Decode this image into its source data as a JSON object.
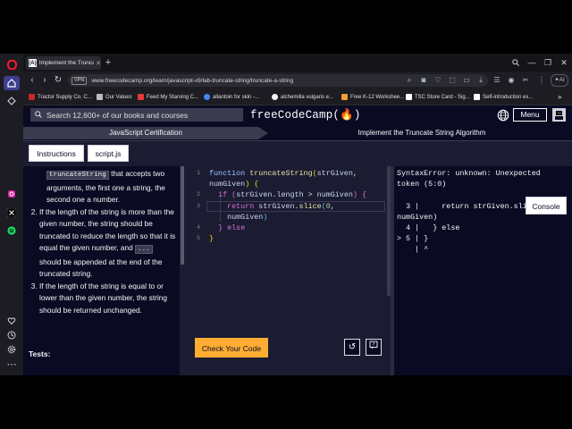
{
  "browser": {
    "tab_title": "Implement the Truncate S",
    "tab_favicon": "(A)",
    "vpn_label": "VPN",
    "url": "www.freecodecamp.org/learn/javascript-v9/lab-truncate-string/truncate-a-string",
    "bookmarks": [
      {
        "label": "Tractor Supply Co. C...",
        "color": "#c62828"
      },
      {
        "label": "Our Values",
        "color": "#bdbdbd"
      },
      {
        "label": "Feed My Starving C...",
        "color": "#e53935"
      },
      {
        "label": "allantoin for skin -...",
        "color": "#4285f4"
      },
      {
        "label": "alchemilla vulgaris e...",
        "color": "#f5f5f5"
      },
      {
        "label": "Free K-12 Workshee...",
        "color": "#f0a030"
      },
      {
        "label": "TSC Store Card - Sig...",
        "color": "#ffffff"
      },
      {
        "label": "Self-introduction ex...",
        "color": "#ffffff"
      }
    ]
  },
  "fcc": {
    "search_placeholder": "Search 12,600+ of our books and courses",
    "logo": "freeCodeCamp(🔥)",
    "menu_label": "Menu",
    "breadcrumb_course": "JavaScript Certification",
    "breadcrumb_lab": "Implement the Truncate String Algorithm"
  },
  "workspace": {
    "instructions_tab": "Instructions",
    "file_tab": "script.js",
    "console_tab": "Console",
    "check_button": "Check Your Code",
    "tests_label": "Tests:"
  },
  "description": {
    "intro_code": "truncateString",
    "intro_text": " that accepts two arguments, the first one a string, the second one a number.",
    "item2_text": "If the length of the string is more than the given number, the string should be truncated to reduce the length so that it is equal the given number, and ",
    "item2_code": "...",
    "item2_tail": " should be appended at the end of the truncated string.",
    "item3_text": "If the length of the string is equal to or lower than the given number, the string should be returned unchanged."
  },
  "editor": {
    "line_numbers": [
      "1",
      "2",
      "3",
      "4",
      "5"
    ]
  },
  "console": {
    "output": "SyntaxError: unknown: Unexpected\ntoken (5:0)\n\n  3 |     return strGiven.slice(0,\nnumGiven)\n  4 |   } else\n> 5 | }\n    | ^"
  }
}
